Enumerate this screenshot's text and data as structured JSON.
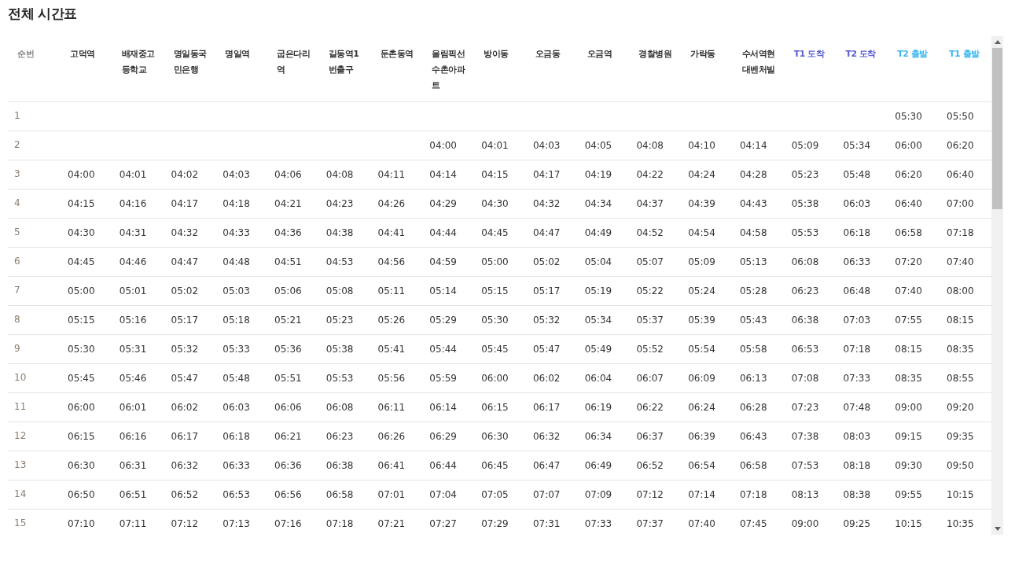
{
  "title": "전체 시간표",
  "table": {
    "columns": [
      {
        "label": "순번",
        "kind": "index"
      },
      {
        "label": "고덕역",
        "kind": "station"
      },
      {
        "label": "배재중고등학교",
        "kind": "station"
      },
      {
        "label": "명일동국민은행",
        "kind": "station"
      },
      {
        "label": "명일역",
        "kind": "station"
      },
      {
        "label": "굽은다리역",
        "kind": "station"
      },
      {
        "label": "길동역1번출구",
        "kind": "station"
      },
      {
        "label": "둔촌동역",
        "kind": "station"
      },
      {
        "label": "올림픽선수촌아파트",
        "kind": "station"
      },
      {
        "label": "방이동",
        "kind": "station"
      },
      {
        "label": "오금동",
        "kind": "station"
      },
      {
        "label": "오금역",
        "kind": "station"
      },
      {
        "label": "경찰병원",
        "kind": "station"
      },
      {
        "label": "가락동",
        "kind": "station"
      },
      {
        "label": "수서역현대벤처빌",
        "kind": "station"
      },
      {
        "label": "T1 도착",
        "kind": "arrival"
      },
      {
        "label": "T2 도착",
        "kind": "arrival"
      },
      {
        "label": "T2 출발",
        "kind": "departure"
      },
      {
        "label": "T1 출발",
        "kind": "departure"
      }
    ],
    "rows": [
      {
        "no": "1",
        "times": [
          "05:30",
          "05:50"
        ]
      },
      {
        "no": "2",
        "times": [
          "04:00",
          "04:01",
          "04:03",
          "04:05",
          "04:08",
          "04:10",
          "04:14",
          "05:09",
          "05:34",
          "06:00",
          "06:20"
        ]
      },
      {
        "no": "3",
        "times": [
          "04:00",
          "04:01",
          "04:02",
          "04:03",
          "04:06",
          "04:08",
          "04:11",
          "04:14",
          "04:15",
          "04:17",
          "04:19",
          "04:22",
          "04:24",
          "04:28",
          "05:23",
          "05:48",
          "06:20",
          "06:40"
        ]
      },
      {
        "no": "4",
        "times": [
          "04:15",
          "04:16",
          "04:17",
          "04:18",
          "04:21",
          "04:23",
          "04:26",
          "04:29",
          "04:30",
          "04:32",
          "04:34",
          "04:37",
          "04:39",
          "04:43",
          "05:38",
          "06:03",
          "06:40",
          "07:00"
        ]
      },
      {
        "no": "5",
        "times": [
          "04:30",
          "04:31",
          "04:32",
          "04:33",
          "04:36",
          "04:38",
          "04:41",
          "04:44",
          "04:45",
          "04:47",
          "04:49",
          "04:52",
          "04:54",
          "04:58",
          "05:53",
          "06:18",
          "06:58",
          "07:18"
        ]
      },
      {
        "no": "6",
        "times": [
          "04:45",
          "04:46",
          "04:47",
          "04:48",
          "04:51",
          "04:53",
          "04:56",
          "04:59",
          "05:00",
          "05:02",
          "05:04",
          "05:07",
          "05:09",
          "05:13",
          "06:08",
          "06:33",
          "07:20",
          "07:40"
        ]
      },
      {
        "no": "7",
        "times": [
          "05:00",
          "05:01",
          "05:02",
          "05:03",
          "05:06",
          "05:08",
          "05:11",
          "05:14",
          "05:15",
          "05:17",
          "05:19",
          "05:22",
          "05:24",
          "05:28",
          "06:23",
          "06:48",
          "07:40",
          "08:00"
        ]
      },
      {
        "no": "8",
        "times": [
          "05:15",
          "05:16",
          "05:17",
          "05:18",
          "05:21",
          "05:23",
          "05:26",
          "05:29",
          "05:30",
          "05:32",
          "05:34",
          "05:37",
          "05:39",
          "05:43",
          "06:38",
          "07:03",
          "07:55",
          "08:15"
        ]
      },
      {
        "no": "9",
        "times": [
          "05:30",
          "05:31",
          "05:32",
          "05:33",
          "05:36",
          "05:38",
          "05:41",
          "05:44",
          "05:45",
          "05:47",
          "05:49",
          "05:52",
          "05:54",
          "05:58",
          "06:53",
          "07:18",
          "08:15",
          "08:35"
        ]
      },
      {
        "no": "10",
        "times": [
          "05:45",
          "05:46",
          "05:47",
          "05:48",
          "05:51",
          "05:53",
          "05:56",
          "05:59",
          "06:00",
          "06:02",
          "06:04",
          "06:07",
          "06:09",
          "06:13",
          "07:08",
          "07:33",
          "08:35",
          "08:55"
        ]
      },
      {
        "no": "11",
        "times": [
          "06:00",
          "06:01",
          "06:02",
          "06:03",
          "06:06",
          "06:08",
          "06:11",
          "06:14",
          "06:15",
          "06:17",
          "06:19",
          "06:22",
          "06:24",
          "06:28",
          "07:23",
          "07:48",
          "09:00",
          "09:20"
        ]
      },
      {
        "no": "12",
        "times": [
          "06:15",
          "06:16",
          "06:17",
          "06:18",
          "06:21",
          "06:23",
          "06:26",
          "06:29",
          "06:30",
          "06:32",
          "06:34",
          "06:37",
          "06:39",
          "06:43",
          "07:38",
          "08:03",
          "09:15",
          "09:35"
        ]
      },
      {
        "no": "13",
        "times": [
          "06:30",
          "06:31",
          "06:32",
          "06:33",
          "06:36",
          "06:38",
          "06:41",
          "06:44",
          "06:45",
          "06:47",
          "06:49",
          "06:52",
          "06:54",
          "06:58",
          "07:53",
          "08:18",
          "09:30",
          "09:50"
        ]
      },
      {
        "no": "14",
        "times": [
          "06:50",
          "06:51",
          "06:52",
          "06:53",
          "06:56",
          "06:58",
          "07:01",
          "07:04",
          "07:05",
          "07:07",
          "07:09",
          "07:12",
          "07:14",
          "07:18",
          "08:13",
          "08:38",
          "09:55",
          "10:15"
        ]
      },
      {
        "no": "15",
        "times": [
          "07:10",
          "07:11",
          "07:12",
          "07:13",
          "07:16",
          "07:18",
          "07:21",
          "07:27",
          "07:29",
          "07:31",
          "07:33",
          "07:37",
          "07:40",
          "07:45",
          "09:00",
          "09:25",
          "10:15",
          "10:35"
        ]
      }
    ]
  }
}
